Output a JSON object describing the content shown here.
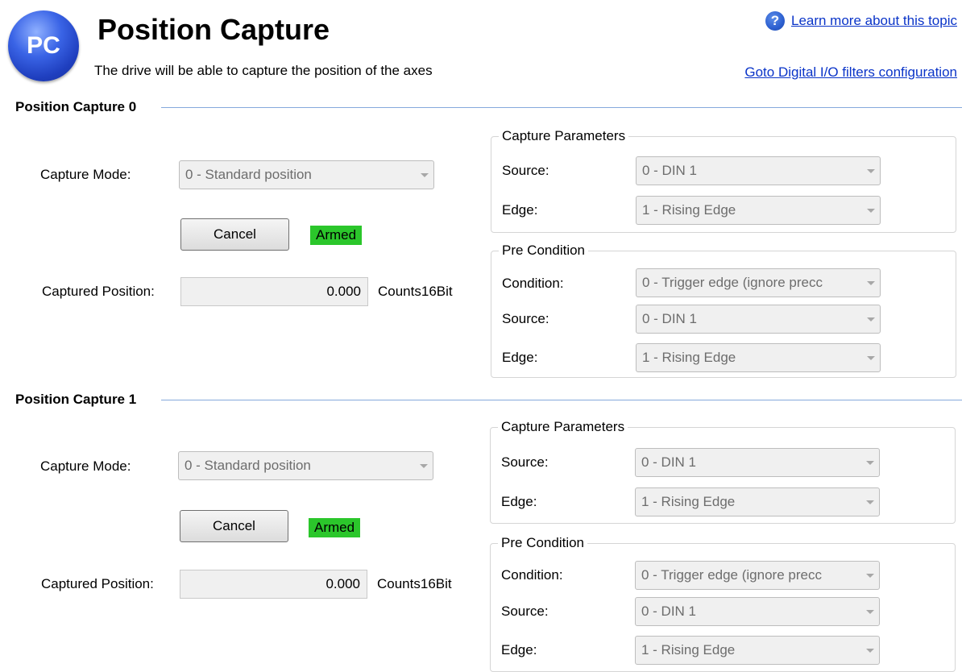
{
  "header": {
    "logo_text": "PC",
    "title": "Position Capture",
    "subtitle": "The drive will be able to capture the position of the axes",
    "help_icon": "question-icon",
    "help_link": "Learn more about this topic",
    "goto_link": "Goto Digital I/O filters configuration"
  },
  "labels": {
    "capture_mode": "Capture Mode:",
    "captured_position": "Captured Position:",
    "units": "Counts16Bit",
    "capture_parameters": "Capture Parameters",
    "pre_condition": "Pre Condition",
    "source": "Source:",
    "edge": "Edge:",
    "condition": "Condition:"
  },
  "colors": {
    "accent_line": "#85a9dc",
    "armed": "#2bc62b",
    "link": "#0a34c8"
  },
  "sections": [
    {
      "title": "Position Capture 0",
      "capture_mode": "0 - Standard position",
      "cancel": "Cancel",
      "status": "Armed",
      "captured_position": "0.000",
      "capture_source": "0 - DIN 1",
      "capture_edge": "1 - Rising Edge",
      "pre_condition": "0 - Trigger edge (ignore precc",
      "pre_source": "0 - DIN 1",
      "pre_edge": "1 - Rising Edge"
    },
    {
      "title": "Position Capture 1",
      "capture_mode": "0 - Standard position",
      "cancel": "Cancel",
      "status": "Armed",
      "captured_position": "0.000",
      "capture_source": "0 - DIN 1",
      "capture_edge": "1 - Rising Edge",
      "pre_condition": "0 - Trigger edge (ignore precc",
      "pre_source": "0 - DIN 1",
      "pre_edge": "1 - Rising Edge"
    }
  ]
}
